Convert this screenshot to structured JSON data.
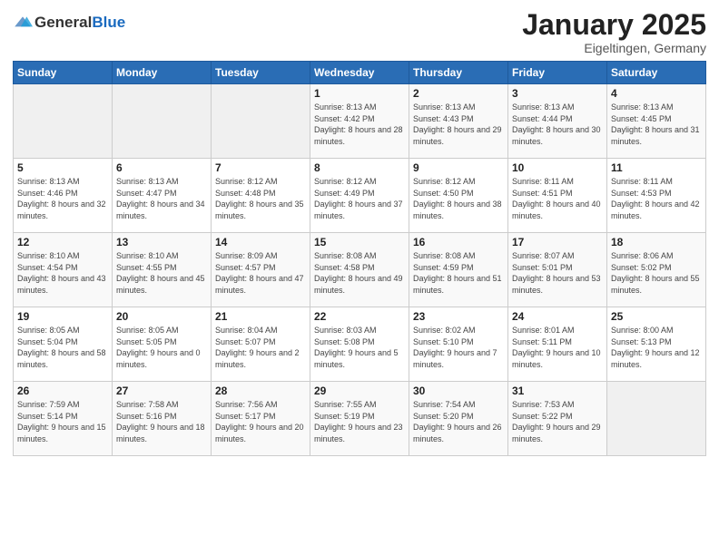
{
  "logo": {
    "general": "General",
    "blue": "Blue"
  },
  "header": {
    "title": "January 2025",
    "subtitle": "Eigeltingen, Germany"
  },
  "days_of_week": [
    "Sunday",
    "Monday",
    "Tuesday",
    "Wednesday",
    "Thursday",
    "Friday",
    "Saturday"
  ],
  "weeks": [
    [
      {
        "day": "",
        "sunrise": "",
        "sunset": "",
        "daylight": ""
      },
      {
        "day": "",
        "sunrise": "",
        "sunset": "",
        "daylight": ""
      },
      {
        "day": "",
        "sunrise": "",
        "sunset": "",
        "daylight": ""
      },
      {
        "day": "1",
        "sunrise": "Sunrise: 8:13 AM",
        "sunset": "Sunset: 4:42 PM",
        "daylight": "Daylight: 8 hours and 28 minutes."
      },
      {
        "day": "2",
        "sunrise": "Sunrise: 8:13 AM",
        "sunset": "Sunset: 4:43 PM",
        "daylight": "Daylight: 8 hours and 29 minutes."
      },
      {
        "day": "3",
        "sunrise": "Sunrise: 8:13 AM",
        "sunset": "Sunset: 4:44 PM",
        "daylight": "Daylight: 8 hours and 30 minutes."
      },
      {
        "day": "4",
        "sunrise": "Sunrise: 8:13 AM",
        "sunset": "Sunset: 4:45 PM",
        "daylight": "Daylight: 8 hours and 31 minutes."
      }
    ],
    [
      {
        "day": "5",
        "sunrise": "Sunrise: 8:13 AM",
        "sunset": "Sunset: 4:46 PM",
        "daylight": "Daylight: 8 hours and 32 minutes."
      },
      {
        "day": "6",
        "sunrise": "Sunrise: 8:13 AM",
        "sunset": "Sunset: 4:47 PM",
        "daylight": "Daylight: 8 hours and 34 minutes."
      },
      {
        "day": "7",
        "sunrise": "Sunrise: 8:12 AM",
        "sunset": "Sunset: 4:48 PM",
        "daylight": "Daylight: 8 hours and 35 minutes."
      },
      {
        "day": "8",
        "sunrise": "Sunrise: 8:12 AM",
        "sunset": "Sunset: 4:49 PM",
        "daylight": "Daylight: 8 hours and 37 minutes."
      },
      {
        "day": "9",
        "sunrise": "Sunrise: 8:12 AM",
        "sunset": "Sunset: 4:50 PM",
        "daylight": "Daylight: 8 hours and 38 minutes."
      },
      {
        "day": "10",
        "sunrise": "Sunrise: 8:11 AM",
        "sunset": "Sunset: 4:51 PM",
        "daylight": "Daylight: 8 hours and 40 minutes."
      },
      {
        "day": "11",
        "sunrise": "Sunrise: 8:11 AM",
        "sunset": "Sunset: 4:53 PM",
        "daylight": "Daylight: 8 hours and 42 minutes."
      }
    ],
    [
      {
        "day": "12",
        "sunrise": "Sunrise: 8:10 AM",
        "sunset": "Sunset: 4:54 PM",
        "daylight": "Daylight: 8 hours and 43 minutes."
      },
      {
        "day": "13",
        "sunrise": "Sunrise: 8:10 AM",
        "sunset": "Sunset: 4:55 PM",
        "daylight": "Daylight: 8 hours and 45 minutes."
      },
      {
        "day": "14",
        "sunrise": "Sunrise: 8:09 AM",
        "sunset": "Sunset: 4:57 PM",
        "daylight": "Daylight: 8 hours and 47 minutes."
      },
      {
        "day": "15",
        "sunrise": "Sunrise: 8:08 AM",
        "sunset": "Sunset: 4:58 PM",
        "daylight": "Daylight: 8 hours and 49 minutes."
      },
      {
        "day": "16",
        "sunrise": "Sunrise: 8:08 AM",
        "sunset": "Sunset: 4:59 PM",
        "daylight": "Daylight: 8 hours and 51 minutes."
      },
      {
        "day": "17",
        "sunrise": "Sunrise: 8:07 AM",
        "sunset": "Sunset: 5:01 PM",
        "daylight": "Daylight: 8 hours and 53 minutes."
      },
      {
        "day": "18",
        "sunrise": "Sunrise: 8:06 AM",
        "sunset": "Sunset: 5:02 PM",
        "daylight": "Daylight: 8 hours and 55 minutes."
      }
    ],
    [
      {
        "day": "19",
        "sunrise": "Sunrise: 8:05 AM",
        "sunset": "Sunset: 5:04 PM",
        "daylight": "Daylight: 8 hours and 58 minutes."
      },
      {
        "day": "20",
        "sunrise": "Sunrise: 8:05 AM",
        "sunset": "Sunset: 5:05 PM",
        "daylight": "Daylight: 9 hours and 0 minutes."
      },
      {
        "day": "21",
        "sunrise": "Sunrise: 8:04 AM",
        "sunset": "Sunset: 5:07 PM",
        "daylight": "Daylight: 9 hours and 2 minutes."
      },
      {
        "day": "22",
        "sunrise": "Sunrise: 8:03 AM",
        "sunset": "Sunset: 5:08 PM",
        "daylight": "Daylight: 9 hours and 5 minutes."
      },
      {
        "day": "23",
        "sunrise": "Sunrise: 8:02 AM",
        "sunset": "Sunset: 5:10 PM",
        "daylight": "Daylight: 9 hours and 7 minutes."
      },
      {
        "day": "24",
        "sunrise": "Sunrise: 8:01 AM",
        "sunset": "Sunset: 5:11 PM",
        "daylight": "Daylight: 9 hours and 10 minutes."
      },
      {
        "day": "25",
        "sunrise": "Sunrise: 8:00 AM",
        "sunset": "Sunset: 5:13 PM",
        "daylight": "Daylight: 9 hours and 12 minutes."
      }
    ],
    [
      {
        "day": "26",
        "sunrise": "Sunrise: 7:59 AM",
        "sunset": "Sunset: 5:14 PM",
        "daylight": "Daylight: 9 hours and 15 minutes."
      },
      {
        "day": "27",
        "sunrise": "Sunrise: 7:58 AM",
        "sunset": "Sunset: 5:16 PM",
        "daylight": "Daylight: 9 hours and 18 minutes."
      },
      {
        "day": "28",
        "sunrise": "Sunrise: 7:56 AM",
        "sunset": "Sunset: 5:17 PM",
        "daylight": "Daylight: 9 hours and 20 minutes."
      },
      {
        "day": "29",
        "sunrise": "Sunrise: 7:55 AM",
        "sunset": "Sunset: 5:19 PM",
        "daylight": "Daylight: 9 hours and 23 minutes."
      },
      {
        "day": "30",
        "sunrise": "Sunrise: 7:54 AM",
        "sunset": "Sunset: 5:20 PM",
        "daylight": "Daylight: 9 hours and 26 minutes."
      },
      {
        "day": "31",
        "sunrise": "Sunrise: 7:53 AM",
        "sunset": "Sunset: 5:22 PM",
        "daylight": "Daylight: 9 hours and 29 minutes."
      },
      {
        "day": "",
        "sunrise": "",
        "sunset": "",
        "daylight": ""
      }
    ]
  ]
}
